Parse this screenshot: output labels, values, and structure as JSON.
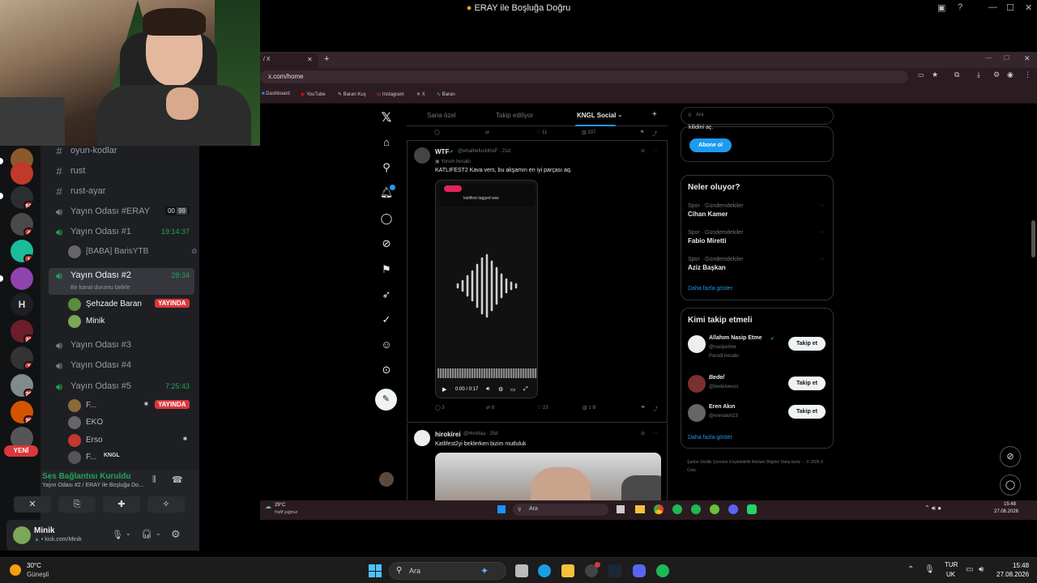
{
  "window": {
    "title": "ERAY ile Boşluğa Doğru"
  },
  "discord": {
    "channels": [
      {
        "icon": "#",
        "label": "oyun-kodlar"
      },
      {
        "icon": "#",
        "label": "rust"
      },
      {
        "icon": "#",
        "label": "rust-ayar"
      },
      {
        "icon": "speaker",
        "label": "Yayın Odası #ERAY",
        "count_a": "00",
        "count_b": "99"
      },
      {
        "icon": "speaker",
        "label": "Yayın Odası #1",
        "timer": "19:14:37"
      },
      {
        "icon": "speaker",
        "label": "Yayın Odası #2",
        "timer": "28:34",
        "status": "Bir kanal durumu belirle"
      },
      {
        "icon": "speaker",
        "label": "Yayın Odası #3"
      },
      {
        "icon": "speaker",
        "label": "Yayın Odası #4"
      },
      {
        "icon": "speaker",
        "label": "Yayın Odası #5",
        "timer": "7:25:43"
      }
    ],
    "users_room1": [
      {
        "name": "[BABA] BarisYTB"
      }
    ],
    "users_room2": [
      {
        "name": "Şehzade Baran",
        "badge": "YAYINDA"
      },
      {
        "name": "Minik"
      }
    ],
    "users_room5": [
      {
        "name": "F...",
        "badge": "YAYINDA"
      },
      {
        "name": "EKO"
      },
      {
        "name": "Erso"
      },
      {
        "name": "F...",
        "tag": "KNGL"
      }
    ],
    "servers": {
      "badges": [
        "50",
        "4",
        "1",
        "23",
        "7",
        "29",
        "29"
      ],
      "letter": "H",
      "new_label": "YENİ"
    },
    "voice": {
      "status": "Ses Bağlantısı Kuruldu",
      "channel": "Yayın Odası #2 / ERAY ile Boşluğa Do..."
    },
    "user": {
      "name": "Minik",
      "sub": "kick.com/Minik"
    }
  },
  "browser": {
    "tab_title": "/ X",
    "url": "x.com/home",
    "bookmarks": [
      "Dashboard",
      "YouTube",
      "Baran Kuş",
      "Instagram",
      "X",
      "Baran"
    ]
  },
  "x": {
    "tabs": [
      "Sana özel",
      "Takip ediliyor",
      "KNGL Social"
    ],
    "top_stats": {
      "likes": "11",
      "views": "337"
    },
    "post1": {
      "author": "WTF",
      "handle": "@whathefuckthisF · 21d",
      "note": "Yorum hesabı",
      "text": "KATLIFEST2 Kava vers, bu akşamın en iyi parçası aq.",
      "video_caption": "katlifest tagged wav",
      "video_time": "0:00 / 0:17",
      "stats": {
        "replies": "3",
        "reposts": "8",
        "likes": "23",
        "views": "1 B"
      }
    },
    "post2": {
      "author": "hirokirei",
      "handle": "@Hirottaa · 25d",
      "text": "Katlifest2yi beklerken bizim mutluluk"
    },
    "search_placeholder": "Ara",
    "premium": {
      "text": "kilidini aç.",
      "button": "Abone ol"
    },
    "trends": {
      "title": "Neler oluyor?",
      "items": [
        {
          "meta": "Spor · Gündemdekiler",
          "name": "Cihan Kamer"
        },
        {
          "meta": "Spor · Gündemdekiler",
          "name": "Fabio Miretti"
        },
        {
          "meta": "Spor · Gündemdekiler",
          "name": "Aziz Başkan"
        }
      ],
      "more": "Daha fazla göster"
    },
    "who_to_follow": {
      "title": "Kimi takip etmeli",
      "items": [
        {
          "name": "Allahım Nasip Etme",
          "handle": "@nasipetme",
          "note": "Parodi hesabı",
          "button": "Takip et"
        },
        {
          "name": "Bedel",
          "handle": "@bedelvevos",
          "button": "Takip et"
        },
        {
          "name": "Eren Akın",
          "handle": "@erenakin23",
          "button": "Takip et"
        }
      ],
      "more": "Daha fazla göster"
    },
    "footer": "Şartlar  Gizlilik  Çerezler  Erişilebilirlik  Reklam Bilgileri  Daha fazla ···  © 2026 X Corp."
  },
  "inner_taskbar": {
    "weather": "29°C",
    "weather_sub": "Hafif yağmur",
    "search": "Ara",
    "time": "15:48",
    "date": "27.08.2026"
  },
  "taskbar": {
    "weather_temp": "30°C",
    "weather_desc": "Güneşli",
    "search": "Ara",
    "lang_1": "TUR",
    "lang_2": "UK",
    "time": "15:48",
    "date": "27.08.2026"
  },
  "colors": {
    "accent_green": "#23a55a",
    "live_red": "#da373c",
    "x_blue": "#1d9bf0"
  }
}
